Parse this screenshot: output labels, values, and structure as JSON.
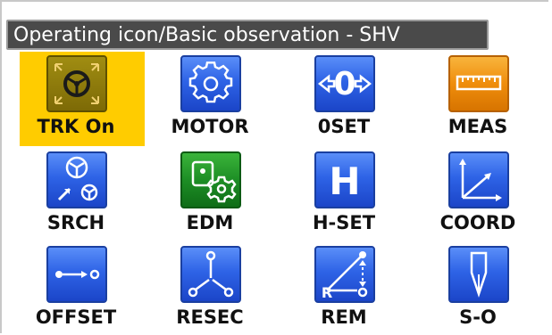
{
  "title": "Operating icon/Basic observation - SHV",
  "tiles": [
    {
      "label": "TRK On",
      "selected": true
    },
    {
      "label": "MOTOR"
    },
    {
      "label": "0SET"
    },
    {
      "label": "MEAS"
    },
    {
      "label": "SRCH"
    },
    {
      "label": "EDM"
    },
    {
      "label": "H-SET"
    },
    {
      "label": "COORD"
    },
    {
      "label": "OFFSET"
    },
    {
      "label": "RESEC"
    },
    {
      "label": "REM"
    },
    {
      "label": "S-O"
    }
  ],
  "icon_glyphs": {
    "0set": "0",
    "h-set": "H"
  },
  "colors": {
    "selection": "#ffcc00",
    "title_bar": "#4a4a4a",
    "blue_icon": "#2e63e6",
    "green_icon": "#1d8e25",
    "orange_icon": "#ef8d0c"
  }
}
